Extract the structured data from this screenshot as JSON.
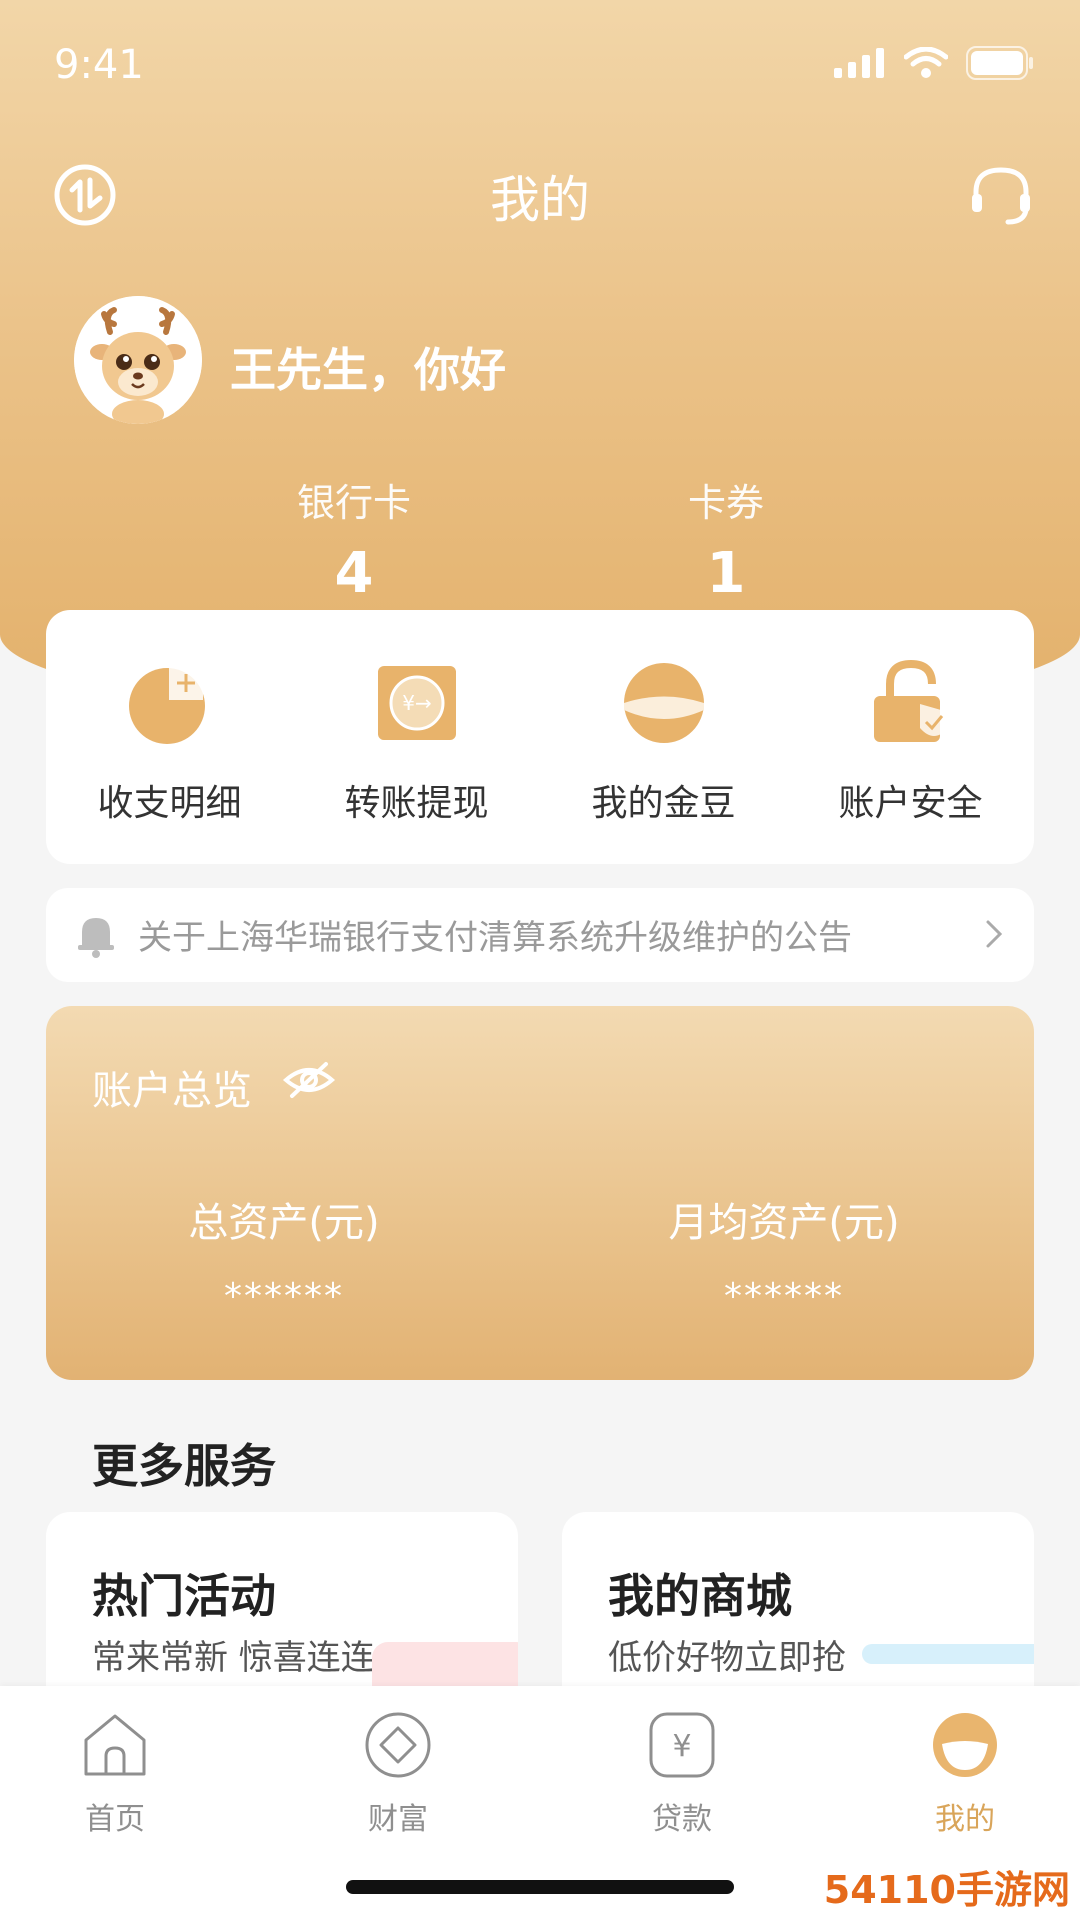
{
  "status_bar": {
    "time": "9:41"
  },
  "header": {
    "title": "我的",
    "left_icon": "stock-chart-icon",
    "right_icon": "headset-icon"
  },
  "profile": {
    "greeting": "王先生，你好",
    "avatar": "deer-mascot-avatar"
  },
  "stats": [
    {
      "label": "银行卡",
      "value": "4"
    },
    {
      "label": "卡券",
      "value": "1"
    }
  ],
  "quick_actions": [
    {
      "label": "收支明细",
      "icon": "income-expense-icon"
    },
    {
      "label": "转账提现",
      "icon": "transfer-icon"
    },
    {
      "label": "我的金豆",
      "icon": "gold-bean-icon"
    },
    {
      "label": "账户安全",
      "icon": "lock-icon"
    }
  ],
  "notice": {
    "text": "关于上海华瑞银行支付清算系统升级维护的公告"
  },
  "overview": {
    "title": "账户总览",
    "total_assets_label": "总资产(元)",
    "total_assets_value": "******",
    "monthly_assets_label": "月均资产(元)",
    "monthly_assets_value": "******"
  },
  "more_services": {
    "title": "更多服务",
    "cards": [
      {
        "title": "热门活动",
        "subtitle": "常来常新 惊喜连连"
      },
      {
        "title": "我的商城",
        "subtitle": "低价好物立即抢"
      }
    ]
  },
  "tabbar": [
    {
      "label": "首页",
      "icon": "home-icon"
    },
    {
      "label": "财富",
      "icon": "diamond-icon"
    },
    {
      "label": "贷款",
      "icon": "yen-icon"
    },
    {
      "label": "我的",
      "icon": "profile-face-icon",
      "active": true
    }
  ],
  "watermark": "54110手游网",
  "colors": {
    "accent": "#e3b06a",
    "tab_active": "#d9a55a"
  }
}
